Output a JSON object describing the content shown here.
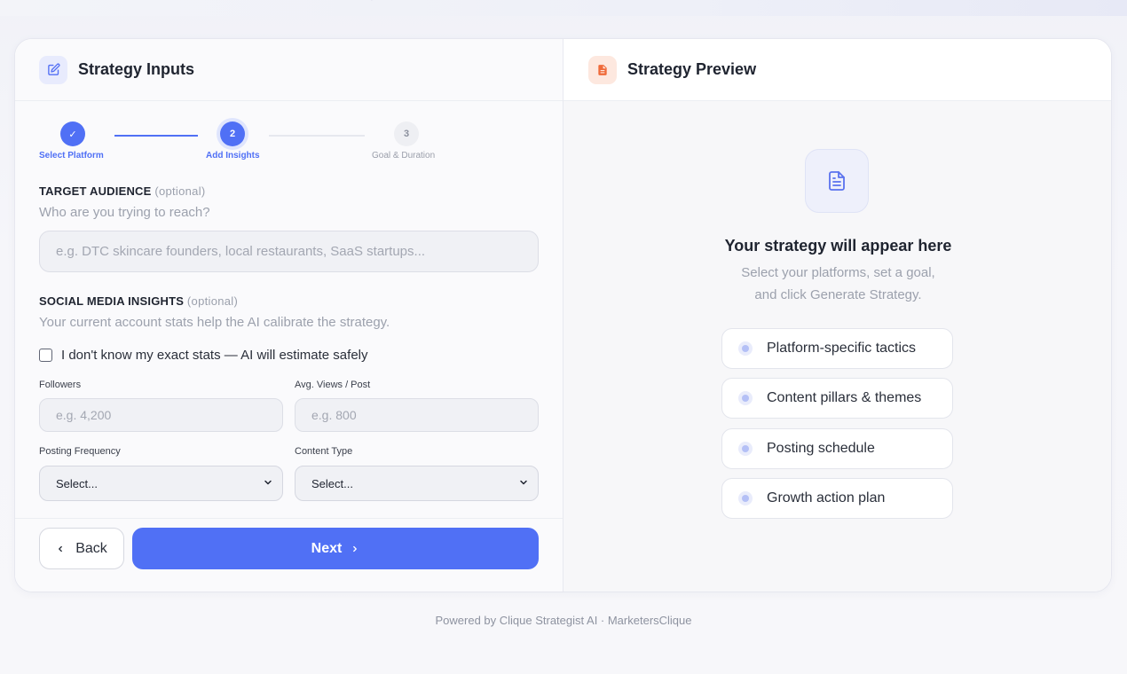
{
  "inputs_panel": {
    "title": "Strategy Inputs",
    "icon": "edit-icon",
    "accent": "#5070f5"
  },
  "stepper": {
    "steps": [
      {
        "number": "✓",
        "label": "Select Platform",
        "state": "done"
      },
      {
        "number": "2",
        "label": "Add Insights",
        "state": "active"
      },
      {
        "number": "3",
        "label": "Goal & Duration",
        "state": "todo"
      }
    ]
  },
  "target_audience": {
    "title": "TARGET AUDIENCE",
    "optional": "(optional)",
    "subtitle": "Who are you trying to reach?",
    "placeholder": "e.g. DTC skincare founders, local restaurants, SaaS startups...",
    "value": ""
  },
  "insights": {
    "title": "SOCIAL MEDIA INSIGHTS",
    "optional": "(optional)",
    "subtitle": "Your current account stats help the AI calibrate the strategy.",
    "checkbox_label": "I don't know my exact stats — AI will estimate safely",
    "checkbox_checked": false,
    "followers_label": "Followers",
    "followers_placeholder": "e.g. 4,200",
    "views_label": "Avg. Views / Post",
    "views_placeholder": "e.g. 800",
    "frequency_label": "Posting Frequency",
    "frequency_value": "Select...",
    "content_type_label": "Content Type",
    "content_type_value": "Select..."
  },
  "buttons": {
    "back": "Back",
    "next": "Next"
  },
  "preview_panel": {
    "title": "Strategy Preview",
    "icon": "document-icon",
    "empty_title": "Your strategy will appear here",
    "empty_sub_line1": "Select your platforms, set a goal,",
    "empty_sub_line2": "and click Generate Strategy.",
    "features": [
      "Platform-specific tactics",
      "Content pillars & themes",
      "Posting schedule",
      "Growth action plan"
    ]
  },
  "footer": {
    "text": "Powered by Clique Strategist AI · MarketersClique"
  }
}
